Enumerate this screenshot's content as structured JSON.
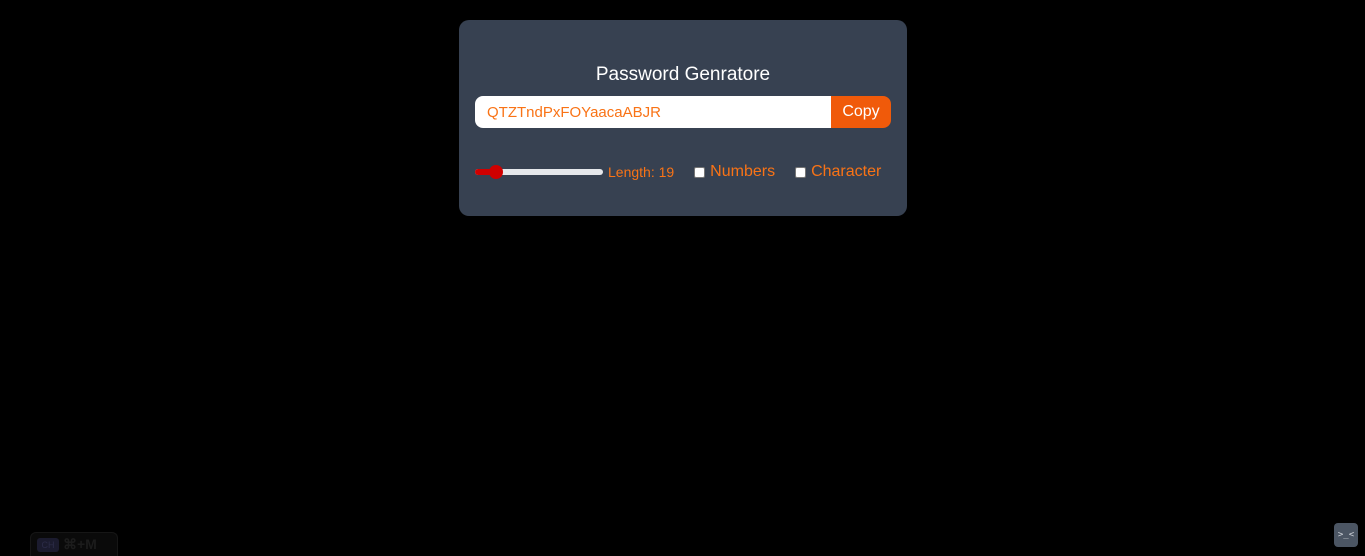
{
  "app": {
    "title": "Password Genratore"
  },
  "password": {
    "value": "QTZTndPxFOYaacaABJR",
    "copy_label": "Copy"
  },
  "length": {
    "min": 8,
    "max": 100,
    "value": 19,
    "label": "Length: 19"
  },
  "options": {
    "numbers": {
      "label": "Numbers",
      "checked": false
    },
    "character": {
      "label": "Character",
      "checked": false
    }
  },
  "overlay": {
    "badge_icon_text": "CH",
    "shortcut": "⌘+M",
    "corner_glyph": ">_<"
  },
  "colors": {
    "background": "#000000",
    "card": "#374151",
    "accent": "#f97316",
    "button": "#f05a0a",
    "slider": "#d00000"
  }
}
